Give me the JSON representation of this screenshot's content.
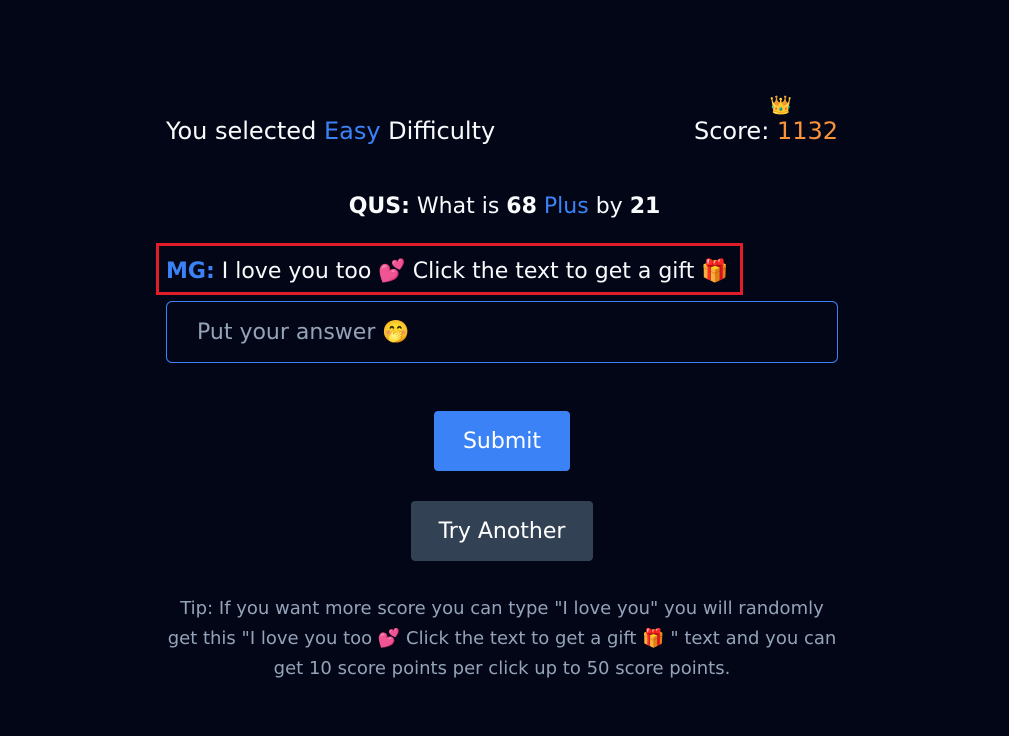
{
  "header": {
    "difficulty_prefix": "You selected",
    "difficulty_level": "Easy",
    "difficulty_suffix": "Difficulty",
    "score_label": "Score:",
    "score_value": "1132",
    "score_icon": "crown-icon"
  },
  "question": {
    "label": "QUS:",
    "prefix": "What is",
    "operand1": "68",
    "operator": "Plus",
    "connector": "by",
    "operand2": "21"
  },
  "message": {
    "label": "MG:",
    "text": "I love you too",
    "heart": "💕",
    "cta": "Click the text to get a gift",
    "gift": "🎁"
  },
  "answer": {
    "placeholder": "Put your answer 🤭"
  },
  "buttons": {
    "submit": "Submit",
    "try_another": "Try Another"
  },
  "tip": {
    "text": "Tip: If you want more score you can type \"I love you\" you will randomly get this \"I love you too 💕  Click the text to get a gift 🎁 \" text and you can get 10 score points per click up to 50 score points."
  },
  "colors": {
    "background": "#020617",
    "accent": "#3b82f6",
    "score": "#fb923c",
    "highlight_border": "#e11d2a",
    "secondary_button": "#334155"
  }
}
